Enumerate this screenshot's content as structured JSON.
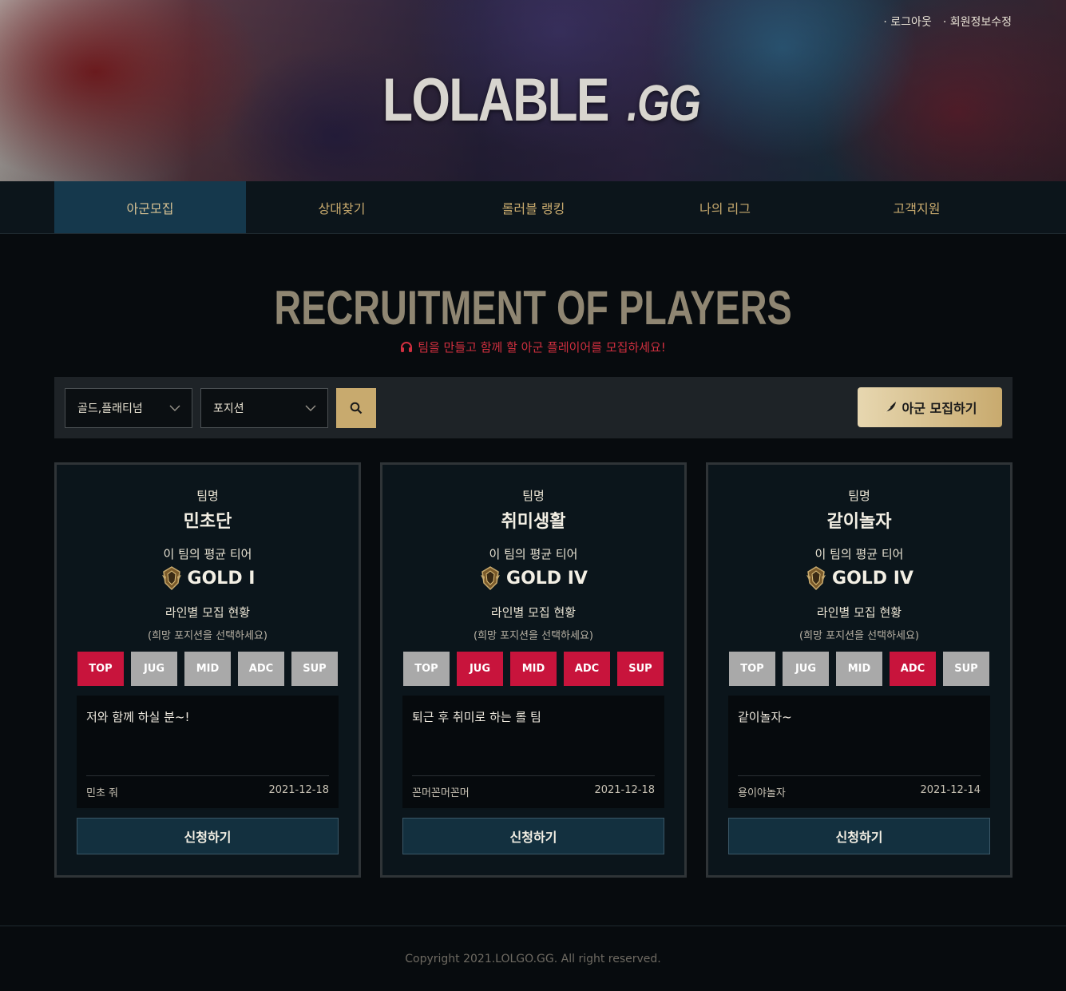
{
  "header": {
    "links": [
      "로그아웃",
      "회원정보수정"
    ],
    "logo_main": "LOLABLE",
    "logo_suffix": ".GG"
  },
  "nav": {
    "items": [
      "아군모집",
      "상대찾기",
      "롤러블 랭킹",
      "나의 리그",
      "고객지원"
    ],
    "active_index": 0
  },
  "page": {
    "title": "RECRUITMENT OF PLAYERS",
    "subtitle": "팀을 만들고 함께 할 아군 플레이어를 모집하세요!"
  },
  "filters": {
    "tier_select": "골드,플래티넘",
    "position_select": "포지션",
    "search_icon": "search-icon",
    "recruit_button": "아군 모집하기"
  },
  "card_labels": {
    "team": "팀명",
    "avg_tier": "이 팀의 평균 티어",
    "lane_status": "라인별 모집 현황",
    "lane_hint": "(희망 포지션을 선택하세요)",
    "apply": "신청하기",
    "positions": [
      "TOP",
      "JUG",
      "MID",
      "ADC",
      "SUP"
    ]
  },
  "cards": [
    {
      "team_name": "민초단",
      "tier": "GOLD I",
      "recruiting": [
        "TOP"
      ],
      "message": "저와 함께 하실 분~!",
      "author": "민초 줘",
      "date": "2021-12-18"
    },
    {
      "team_name": "취미생활",
      "tier": "GOLD IV",
      "recruiting": [
        "JUG",
        "MID",
        "ADC",
        "SUP"
      ],
      "message": "퇴근 후 취미로 하는 롤 팀",
      "author": "꼰머꼰머꼰머",
      "date": "2021-12-18"
    },
    {
      "team_name": "같이놀자",
      "tier": "GOLD IV",
      "recruiting": [
        "ADC"
      ],
      "message": "같이놀자~",
      "author": "용이야놀자",
      "date": "2021-12-14"
    }
  ],
  "colors": {
    "accent_gold": "#c8aa6e",
    "active_red": "#c8143c",
    "inactive_gray": "#a9a9a9",
    "nav_active": "#15384c"
  },
  "footer": {
    "copyright": "Copyright 2021.LOLGO.GG. All right reserved."
  }
}
